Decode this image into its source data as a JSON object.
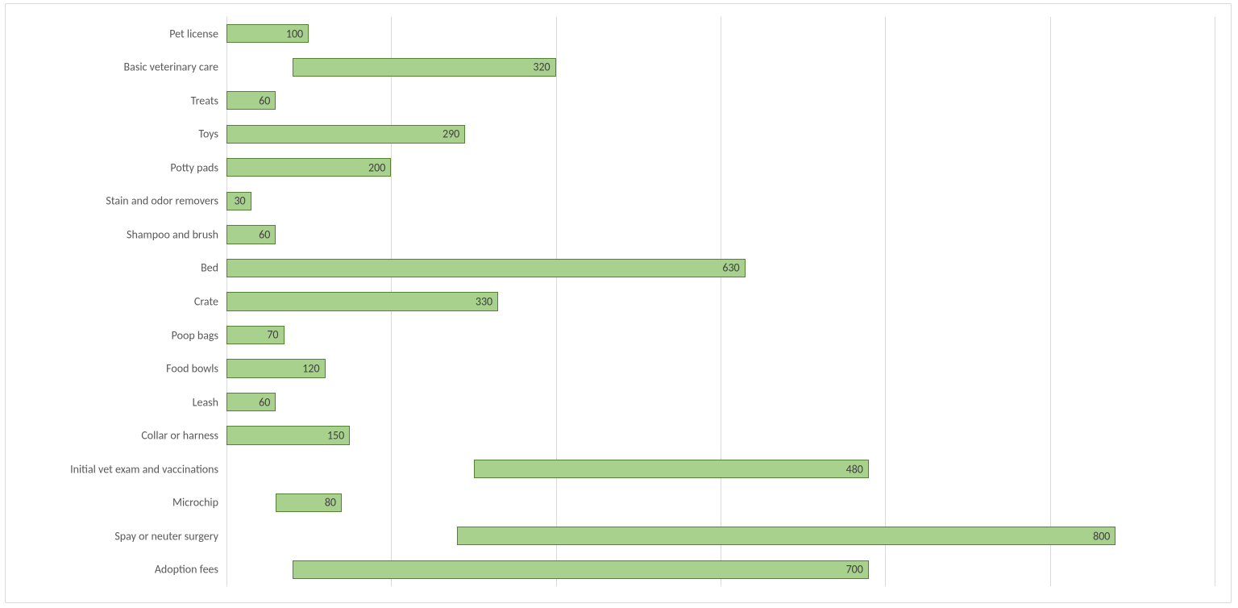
{
  "chart_data": {
    "type": "bar",
    "orientation": "horizontal",
    "floating_bars": true,
    "bar_color": "#a9d18e",
    "bar_border": "#548235",
    "grid_color": "#d9d9d9",
    "value_axis_range": [
      0,
      1200
    ],
    "gridline_interval": 200,
    "categories_top_to_bottom": [
      {
        "label": "Pet license",
        "start": 0,
        "span": 100
      },
      {
        "label": "Basic veterinary care",
        "start": 80,
        "span": 320
      },
      {
        "label": "Treats",
        "start": 0,
        "span": 60
      },
      {
        "label": "Toys",
        "start": 0,
        "span": 290
      },
      {
        "label": "Potty pads",
        "start": 0,
        "span": 200
      },
      {
        "label": "Stain and odor removers",
        "start": 0,
        "span": 30
      },
      {
        "label": "Shampoo and brush",
        "start": 0,
        "span": 60
      },
      {
        "label": "Bed",
        "start": 0,
        "span": 630
      },
      {
        "label": "Crate",
        "start": 0,
        "span": 330
      },
      {
        "label": "Poop bags",
        "start": 0,
        "span": 70
      },
      {
        "label": "Food bowls",
        "start": 0,
        "span": 120
      },
      {
        "label": "Leash",
        "start": 0,
        "span": 60
      },
      {
        "label": "Collar or harness",
        "start": 0,
        "span": 150
      },
      {
        "label": "Initial vet exam and vaccinations",
        "start": 300,
        "span": 480
      },
      {
        "label": "Microchip",
        "start": 60,
        "span": 80
      },
      {
        "label": "Spay or neuter surgery",
        "start": 280,
        "span": 800
      },
      {
        "label": "Adoption fees",
        "start": 80,
        "span": 700
      }
    ]
  }
}
